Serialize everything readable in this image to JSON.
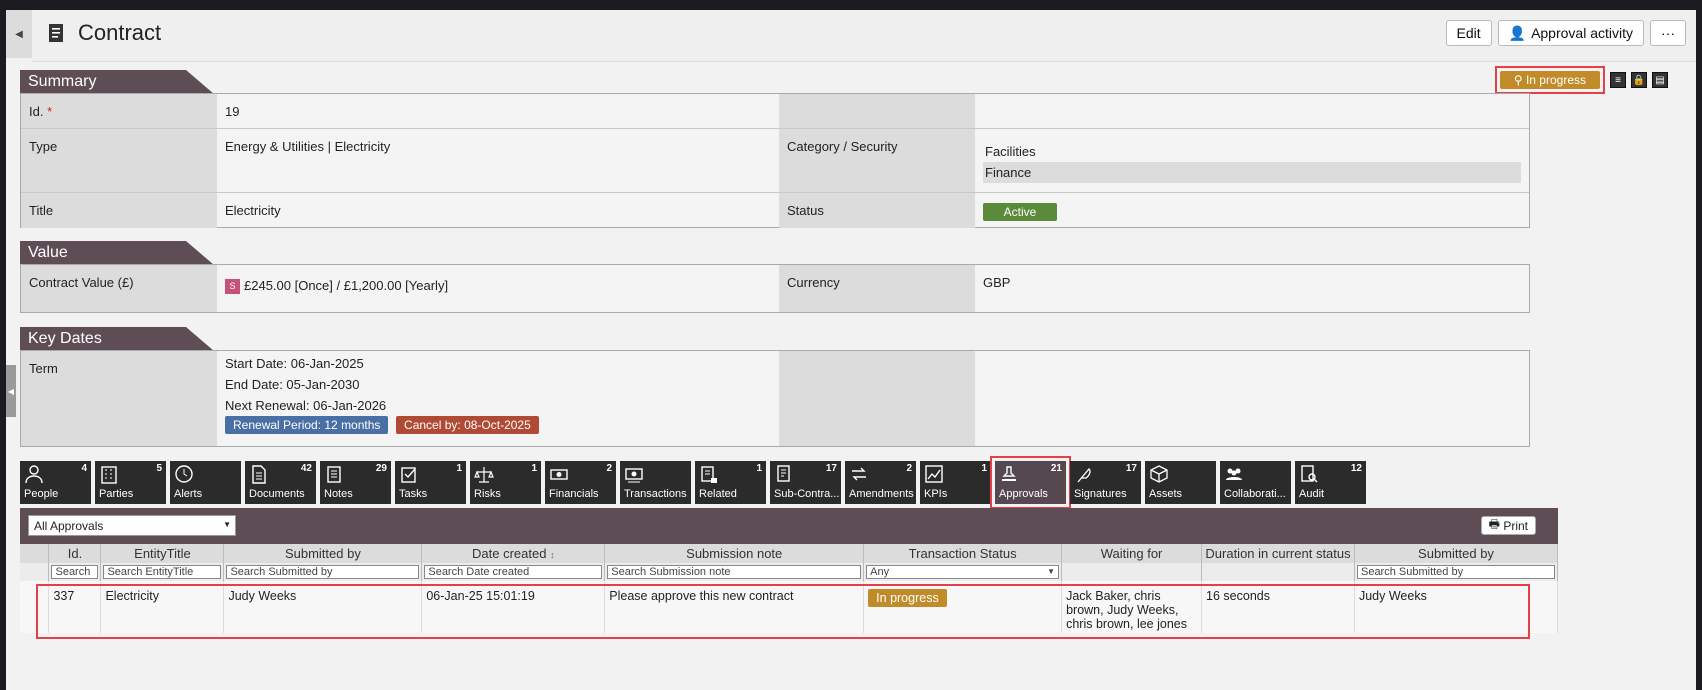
{
  "header": {
    "title": "Contract",
    "edit_label": "Edit",
    "approval_activity_label": "Approval activity",
    "more_label": "···"
  },
  "status_chip": {
    "label": "In progress"
  },
  "summary": {
    "heading": "Summary",
    "id_label": "Id.",
    "id_value": "19",
    "type_label": "Type",
    "type_value": "Energy & Utilities | Electricity",
    "category_label": "Category / Security",
    "category_values": [
      "Facilities",
      "Finance"
    ],
    "title_label": "Title",
    "title_value": "Electricity",
    "status_label": "Status",
    "status_value": "Active"
  },
  "value": {
    "heading": "Value",
    "contract_value_label": "Contract Value (£)",
    "s_tag": "S",
    "contract_value": "£245.00 [Once] / £1,200.00 [Yearly]",
    "currency_label": "Currency",
    "currency_value": "GBP"
  },
  "key_dates": {
    "heading": "Key Dates",
    "term_label": "Term",
    "start": "Start Date: 06-Jan-2025",
    "end": "End Date: 05-Jan-2030",
    "next_renewal": "Next Renewal: 06-Jan-2026",
    "renewal_period": "Renewal Period: 12 months",
    "cancel_by": "Cancel by: 08-Oct-2025"
  },
  "tabs": [
    {
      "label": "People",
      "count": "4",
      "icon": "person-icon"
    },
    {
      "label": "Parties",
      "count": "5",
      "icon": "building-icon"
    },
    {
      "label": "Alerts",
      "count": "",
      "icon": "clock-icon"
    },
    {
      "label": "Documents",
      "count": "42",
      "icon": "document-icon"
    },
    {
      "label": "Notes",
      "count": "29",
      "icon": "notes-icon"
    },
    {
      "label": "Tasks",
      "count": "1",
      "icon": "tasks-icon"
    },
    {
      "label": "Risks",
      "count": "1",
      "icon": "scales-icon"
    },
    {
      "label": "Financials",
      "count": "2",
      "icon": "money-icon"
    },
    {
      "label": "Transactions",
      "count": "",
      "icon": "transactions-icon"
    },
    {
      "label": "Related",
      "count": "1",
      "icon": "related-icon"
    },
    {
      "label": "Sub-Contra...",
      "count": "17",
      "icon": "subcontract-icon"
    },
    {
      "label": "Amendments",
      "count": "2",
      "icon": "arrows-icon"
    },
    {
      "label": "KPIs",
      "count": "1",
      "icon": "chart-icon"
    },
    {
      "label": "Approvals",
      "count": "21",
      "icon": "stamp-icon"
    },
    {
      "label": "Signatures",
      "count": "17",
      "icon": "feather-icon"
    },
    {
      "label": "Assets",
      "count": "",
      "icon": "cube-icon"
    },
    {
      "label": "Collaborati...",
      "count": "",
      "icon": "group-icon"
    },
    {
      "label": "Audit",
      "count": "12",
      "icon": "audit-icon"
    }
  ],
  "approvals": {
    "filter_value": "All Approvals",
    "print_label": "Print",
    "columns": [
      "Id.",
      "EntityTitle",
      "Submitted by",
      "Date created",
      "Submission note",
      "Transaction Status",
      "Waiting for",
      "Duration in current status",
      "Submitted by"
    ],
    "search_placeholders": [
      "Search",
      "Search EntityTitle",
      "Search Submitted by",
      "Search Date created",
      "Search Submission note",
      "Any",
      "",
      "",
      "Search Submitted by"
    ],
    "row": {
      "id": "337",
      "entity": "Electricity",
      "submitted_by": "Judy Weeks",
      "date_created": "06-Jan-25 15:01:19",
      "note": "Please approve this new contract",
      "status": "In progress",
      "waiting_for": "Jack Baker, chris brown, Judy Weeks, chris brown, lee jones",
      "duration": "16 seconds",
      "submitted_by_2": "Judy Weeks"
    }
  }
}
